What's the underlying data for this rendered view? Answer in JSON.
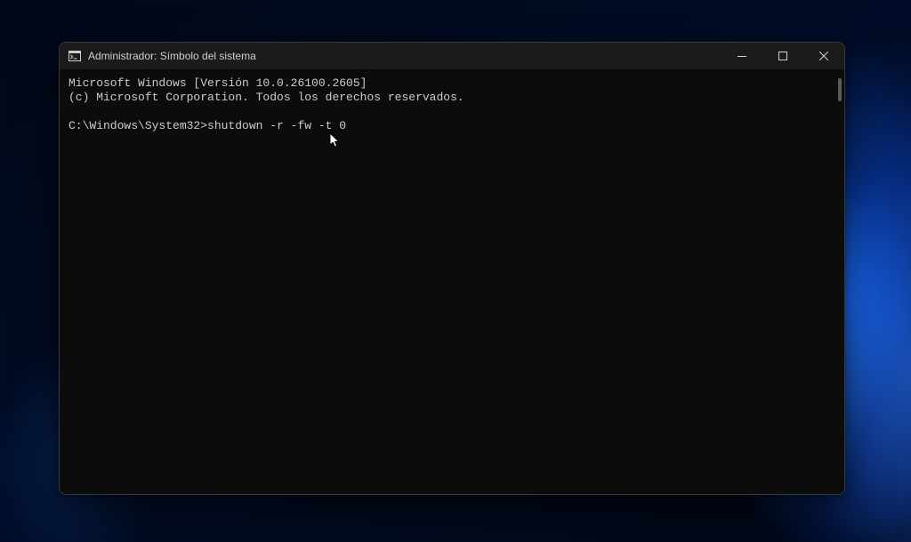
{
  "window": {
    "title": "Administrador: Símbolo del sistema"
  },
  "terminal": {
    "line1": "Microsoft Windows [Versión 10.0.26100.2605]",
    "line2": "(c) Microsoft Corporation. Todos los derechos reservados.",
    "prompt": "C:\\Windows\\System32>",
    "command": "shutdown -r -fw -t 0"
  }
}
